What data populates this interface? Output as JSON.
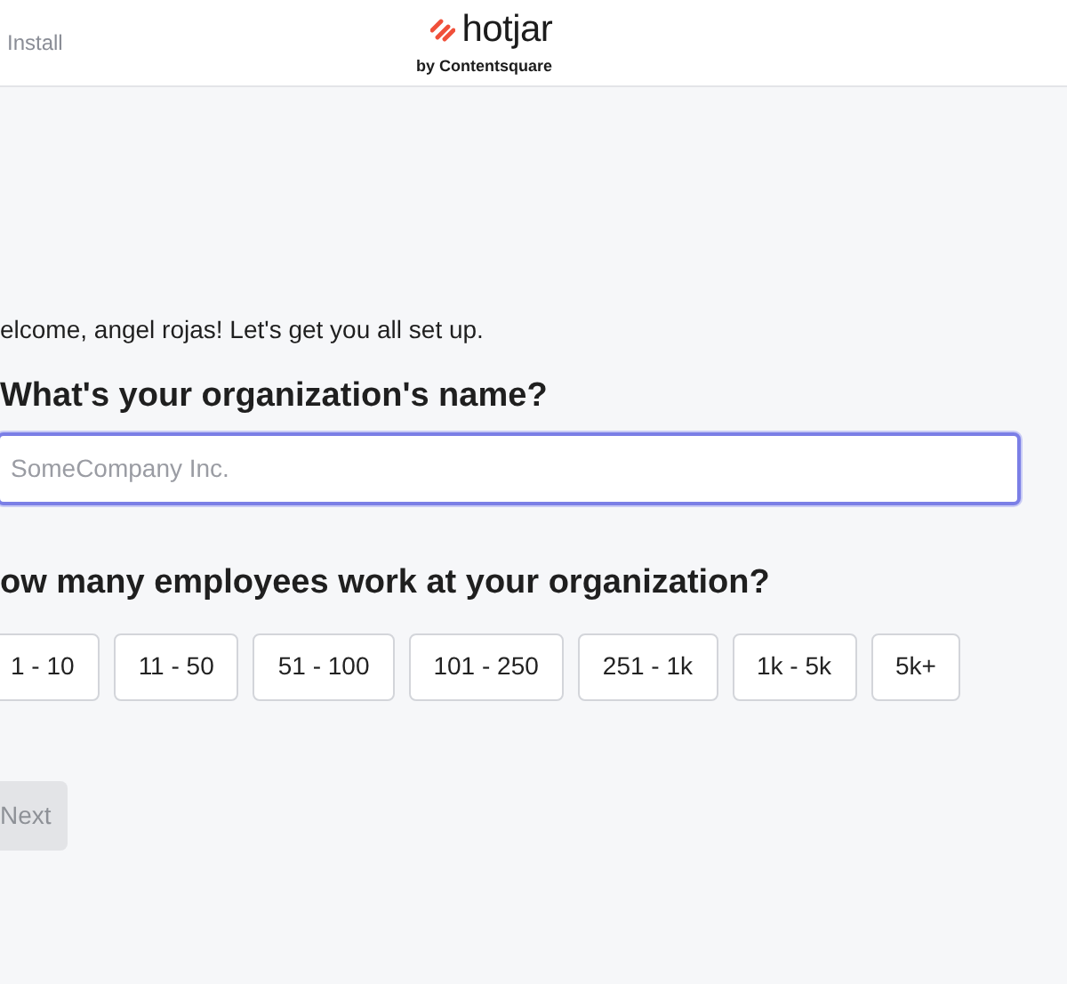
{
  "header": {
    "nav_link": "Install",
    "logo": {
      "name": "hotjar",
      "tagline": "by Contentsquare"
    }
  },
  "welcome": "elcome, angel rojas! Let's get you all set up.",
  "org_name": {
    "question": "What's your organization's name?",
    "placeholder": "SomeCompany Inc.",
    "focused": true
  },
  "employees": {
    "question": "ow many employees work at your organization?",
    "options": [
      {
        "label": "1 - 10",
        "selected": false
      },
      {
        "label": "11 - 50",
        "selected": false
      },
      {
        "label": "51 - 100",
        "selected": false
      },
      {
        "label": "101 - 250",
        "selected": false
      },
      {
        "label": "251 - 1k",
        "selected": false
      },
      {
        "label": "1k - 5k",
        "selected": false
      },
      {
        "label": "5k+",
        "selected": false
      }
    ]
  },
  "next_button": {
    "label": "Next",
    "disabled": true
  }
}
